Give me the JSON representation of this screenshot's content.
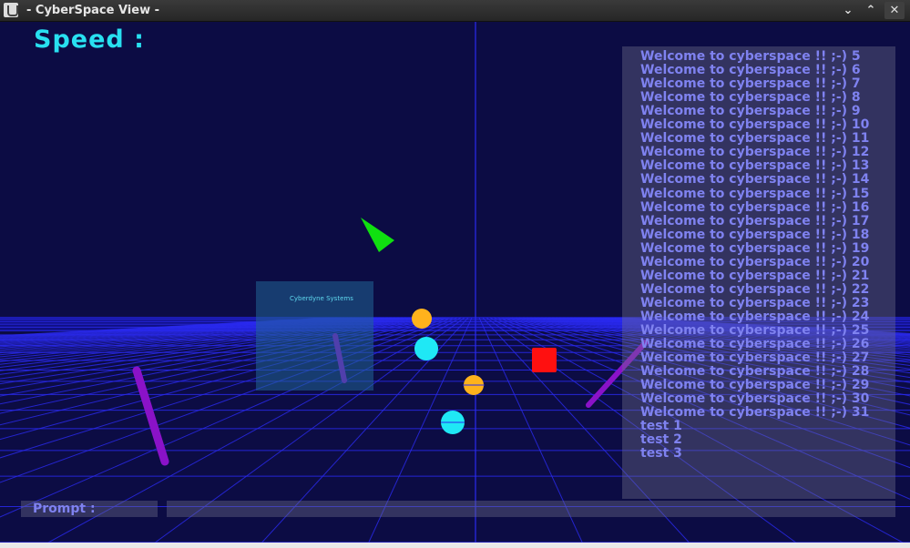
{
  "window": {
    "title": "- CyberSpace View -",
    "icon": "java-app-icon",
    "controls": {
      "minimize": "⌄",
      "maximize": "⌃",
      "close": "✕"
    }
  },
  "hud": {
    "speed_label": "Speed :"
  },
  "log": {
    "lines": [
      "Welcome to cyberspace !! ;-) 5",
      "Welcome to cyberspace !! ;-) 6",
      "Welcome to cyberspace !! ;-) 7",
      "Welcome to cyberspace !! ;-) 8",
      "Welcome to cyberspace !! ;-) 9",
      "Welcome to cyberspace !! ;-) 10",
      "Welcome to cyberspace !! ;-) 11",
      "Welcome to cyberspace !! ;-) 12",
      "Welcome to cyberspace !! ;-) 13",
      "Welcome to cyberspace !! ;-) 14",
      "Welcome to cyberspace !! ;-) 15",
      "Welcome to cyberspace !! ;-) 16",
      "Welcome to cyberspace !! ;-) 17",
      "Welcome to cyberspace !! ;-) 18",
      "Welcome to cyberspace !! ;-) 19",
      "Welcome to cyberspace !! ;-) 20",
      "Welcome to cyberspace !! ;-) 21",
      "Welcome to cyberspace !! ;-) 22",
      "Welcome to cyberspace !! ;-) 23",
      "Welcome to cyberspace !! ;-) 24",
      "Welcome to cyberspace !! ;-) 25",
      "Welcome to cyberspace !! ;-) 26",
      "Welcome to cyberspace !! ;-) 27",
      "Welcome to cyberspace !! ;-) 28",
      "Welcome to cyberspace !! ;-) 29",
      "Welcome to cyberspace !! ;-) 30",
      "Welcome to cyberspace !! ;-) 31",
      "test 1",
      "test 2",
      "test 3"
    ]
  },
  "prompt": {
    "label": "Prompt :",
    "value": ""
  },
  "scene": {
    "screen_label": "Cyberdyne Systems"
  },
  "colors": {
    "background": "#0c0c44",
    "grid": "#2a2af0",
    "hud_text": "#28e0f0",
    "log_text": "#7f82f0",
    "orange_sphere": "#ffb21c",
    "cyan_sphere": "#1fe8f5",
    "red_cube": "#ff1010",
    "green_arrow": "#10e010",
    "purple_rod": "#8a12c8"
  }
}
